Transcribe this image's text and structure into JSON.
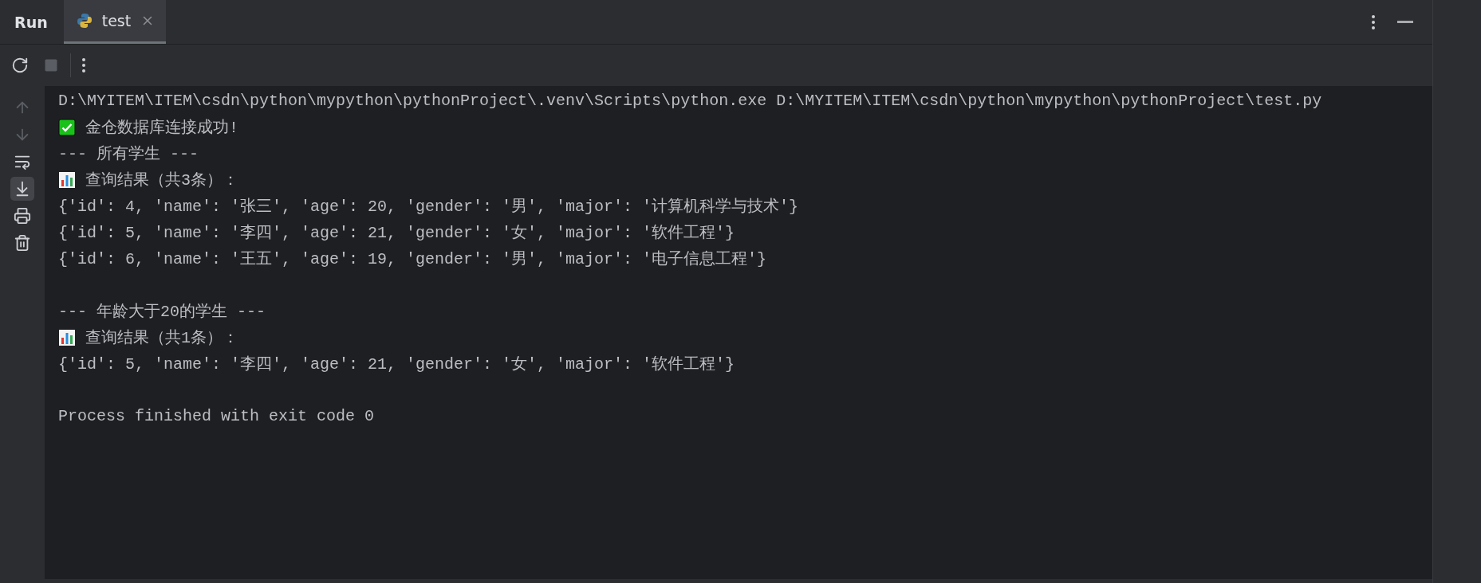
{
  "header": {
    "title": "Run",
    "tabs": [
      {
        "label": "test",
        "selected": true
      }
    ]
  },
  "toolbar": {
    "rerun_disabled": false,
    "stop_disabled": true
  },
  "gutter_tools": [
    {
      "kind": "up",
      "disabled": true,
      "selected": false
    },
    {
      "kind": "down",
      "disabled": true,
      "selected": false
    },
    {
      "kind": "wrap",
      "disabled": false,
      "selected": false
    },
    {
      "kind": "scroll_end",
      "disabled": false,
      "selected": true
    },
    {
      "kind": "print",
      "disabled": false,
      "selected": false
    },
    {
      "kind": "trash",
      "disabled": false,
      "selected": false
    }
  ],
  "console": [
    {
      "kind": "plain",
      "text": "D:\\MYITEM\\ITEM\\csdn\\python\\mypython\\pythonProject\\.venv\\Scripts\\python.exe D:\\MYITEM\\ITEM\\csdn\\python\\mypython\\pythonProject\\test.py"
    },
    {
      "kind": "check",
      "text": "金仓数据库连接成功!"
    },
    {
      "kind": "plain",
      "text": "--- 所有学生 ---"
    },
    {
      "kind": "chart",
      "text": "查询结果（共3条）："
    },
    {
      "kind": "plain",
      "text": "{'id': 4, 'name': '张三', 'age': 20, 'gender': '男', 'major': '计算机科学与技术'}"
    },
    {
      "kind": "plain",
      "text": "{'id': 5, 'name': '李四', 'age': 21, 'gender': '女', 'major': '软件工程'}"
    },
    {
      "kind": "plain",
      "text": "{'id': 6, 'name': '王五', 'age': 19, 'gender': '男', 'major': '电子信息工程'}"
    },
    {
      "kind": "blank"
    },
    {
      "kind": "plain",
      "text": "--- 年龄大于20的学生 ---"
    },
    {
      "kind": "chart",
      "text": "查询结果（共1条）："
    },
    {
      "kind": "plain",
      "text": "{'id': 5, 'name': '李四', 'age': 21, 'gender': '女', 'major': '软件工程'}"
    },
    {
      "kind": "blank"
    },
    {
      "kind": "plain",
      "text": "Process finished with exit code 0"
    }
  ]
}
